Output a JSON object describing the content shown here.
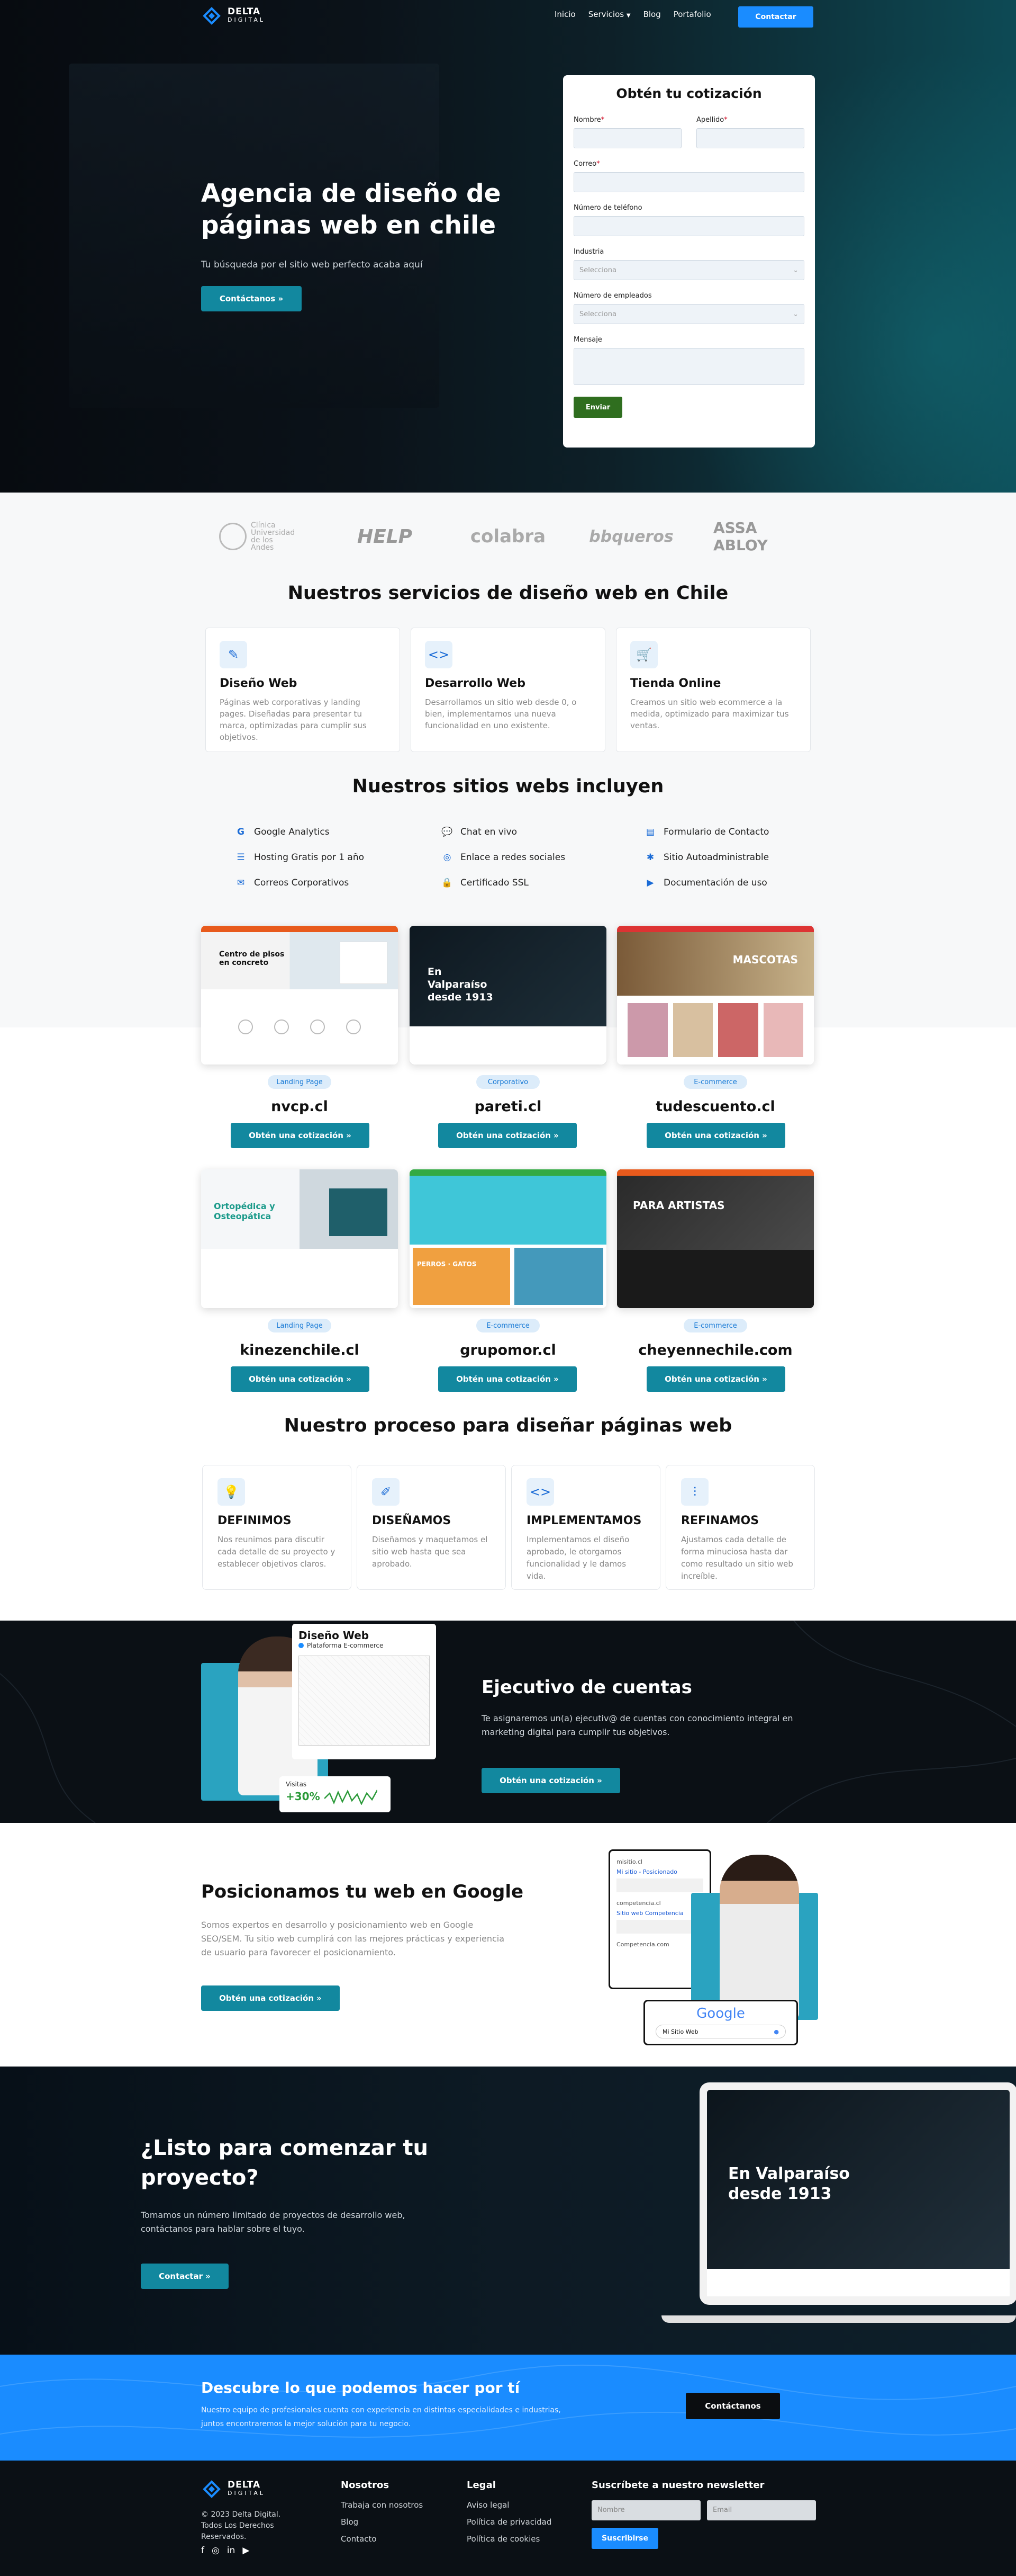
{
  "brand": {
    "name": "DELTA",
    "tagline": "DIGITAL"
  },
  "nav": {
    "items": [
      {
        "label": "Inicio"
      },
      {
        "label": "Servicios"
      },
      {
        "label": "Blog"
      },
      {
        "label": "Portafolio"
      }
    ],
    "cta": "Contactar"
  },
  "hero": {
    "title": "Agencia de diseño de páginas web en chile",
    "subtitle": "Tu búsqueda por el sitio web perfecto acaba aquí",
    "cta": "Contáctanos »"
  },
  "form": {
    "title": "Obtén tu cotización",
    "nombre": "Nombre",
    "apellido": "Apellido",
    "correo": "Correo",
    "telefono": "Número de teléfono",
    "industria": "Industria",
    "industria_placeholder": "Selecciona",
    "empleados": "Número de empleados",
    "empleados_placeholder": "Selecciona",
    "mensaje": "Mensaje",
    "submit": "Enviar"
  },
  "clients": [
    {
      "name": "Clínica Universidad de los Andes"
    },
    {
      "name": "HELP"
    },
    {
      "name": "colabra"
    },
    {
      "name": "bbqueros"
    },
    {
      "name": "ASSA ABLOY"
    }
  ],
  "services": {
    "title": "Nuestros servicios de diseño web en Chile",
    "items": [
      {
        "icon": "pen-icon",
        "title": "Diseño Web",
        "text": "Páginas web corporativas y landing pages. Diseñadas para presentar tu marca, optimizadas para cumplir sus objetivos."
      },
      {
        "icon": "code-icon",
        "title": "Desarrollo Web",
        "text": "Desarrollamos un sitio web desde 0, o bien, implementamos una nueva funcionalidad en uno existente."
      },
      {
        "icon": "cart-icon",
        "title": "Tienda Online",
        "text": "Creamos un sitio web ecommerce a la medida, optimizado para maximizar tus ventas."
      }
    ]
  },
  "includes": {
    "title": "Nuestros sitios webs incluyen",
    "items": [
      {
        "icon": "G",
        "label": "Google Analytics"
      },
      {
        "icon": "💬",
        "label": "Chat en vivo"
      },
      {
        "icon": "▤",
        "label": "Formulario de Contacto"
      },
      {
        "icon": "☰",
        "label": "Hosting Gratis por 1 año"
      },
      {
        "icon": "◎",
        "label": "Enlace a redes sociales"
      },
      {
        "icon": "✱",
        "label": "Sitio Autoadministrable"
      },
      {
        "icon": "✉",
        "label": "Correos Corporativos"
      },
      {
        "icon": "🔒",
        "label": "Certificado SSL"
      },
      {
        "icon": "▶",
        "label": "Documentación de uso"
      }
    ]
  },
  "portfolio": {
    "cta": "Obtén una cotización »",
    "items": [
      {
        "tag": "Landing Page",
        "name": "nvcp.cl",
        "headline": "Centro de pisos en concreto"
      },
      {
        "tag": "Corporativo",
        "name": "pareti.cl",
        "headline": "En Valparaíso desde 1913"
      },
      {
        "tag": "E-commerce",
        "name": "tudescuento.cl",
        "headline": "MASCOTAS"
      },
      {
        "tag": "Landing Page",
        "name": "kinezenchile.cl",
        "headline": "Ortopédica y Osteopática"
      },
      {
        "tag": "E-commerce",
        "name": "grupomor.cl",
        "headline": "PERROS · GATOS"
      },
      {
        "tag": "E-commerce",
        "name": "cheyennechile.com",
        "headline": "PARA ARTISTAS"
      }
    ]
  },
  "process": {
    "title": "Nuestro proceso para diseñar páginas web",
    "items": [
      {
        "icon": "bulb-icon",
        "title": "DEFINIMOS",
        "text": "Nos reunimos para discutir cada detalle de su proyecto y establecer objetivos claros."
      },
      {
        "icon": "design-icon",
        "title": "DISEÑAMOS",
        "text": "Diseñamos y maquetamos el sitio web hasta que sea aprobado."
      },
      {
        "icon": "code-icon",
        "title": "IMPLEMENTAMOS",
        "text": "Implementamos el diseño aprobado, le otorgamos funcionalidad y le damos vida."
      },
      {
        "icon": "sliders-icon",
        "title": "REFINAMOS",
        "text": "Ajustamos cada detalle de forma minuciosa hasta dar como resultado un sitio web increíble."
      }
    ]
  },
  "exec": {
    "title": "Ejecutivo de cuentas",
    "text": "Te asignaremos un(a) ejecutiv@ de cuentas con conocimiento integral en marketing digital para cumplir tus objetivos.",
    "cta": "Obtén una cotización »",
    "card_title": "Diseño Web",
    "card_sub": "Plataforma E-commerce",
    "visits_label": "Visitas",
    "visits_value": "+30%"
  },
  "google": {
    "title": "Posicionamos tu web en Google",
    "text": "Somos expertos en desarrollo y posicionamiento web en Google SEO/SEM. Tu sitio web cumplirá con las mejores prácticas y experiencia de usuario para favorecer el posicionamiento.",
    "cta": "Obtén una cotización »",
    "result1_url": "misitio.cl",
    "result1_title": "Mi sitio - Posicionado",
    "result2_url": "competencia.cl",
    "result2_title": "Sitio web Competencia",
    "result3_url": "Competencia.com",
    "search_logo": "Google",
    "search_query": "Mi Sitio Web"
  },
  "cta": {
    "title": "¿Listo para comenzar tu proyecto?",
    "text": "Tomamos un número limitado de proyectos de desarrollo web, contáctanos para hablar sobre el tuyo.",
    "button": "Contactar »",
    "laptop_headline": "En Valparaíso desde 1913"
  },
  "band": {
    "title": "Descubre lo que podemos hacer por tí",
    "text": "Nuestro equipo de profesionales cuenta con experiencia en distintas especialidades e industrias, juntos encontraremos la mejor solución para tu negocio.",
    "button": "Contáctanos"
  },
  "footer": {
    "copyright": "© 2023 Delta Digital. Todos Los Derechos Reservados.",
    "col1_title": "Nosotros",
    "col1": [
      {
        "label": "Trabaja con nosotros"
      },
      {
        "label": "Blog"
      },
      {
        "label": "Contacto"
      }
    ],
    "col2_title": "Legal",
    "col2": [
      {
        "label": "Aviso legal"
      },
      {
        "label": "Política de privacidad"
      },
      {
        "label": "Política de cookies"
      }
    ],
    "newsletter_title": "Suscríbete a nuestro newsletter",
    "name_placeholder": "Nombre",
    "email_placeholder": "Email",
    "subscribe": "Suscribirse"
  },
  "colors": {
    "accent": "#1a8cff",
    "teal": "#12889f",
    "green": "#2f6e1f",
    "dark": "#0b1015"
  }
}
